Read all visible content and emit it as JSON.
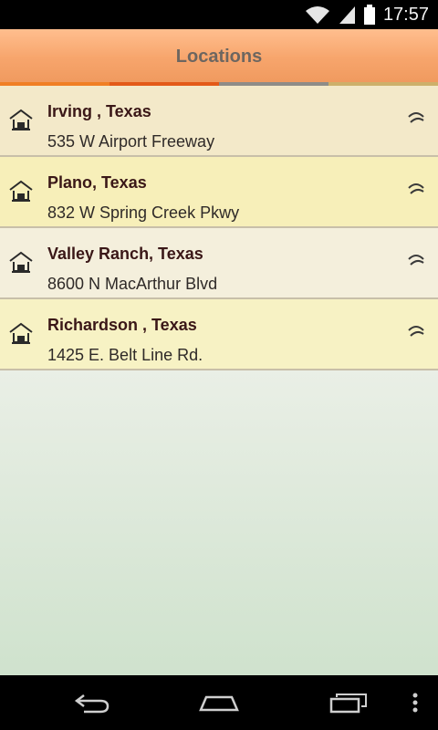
{
  "status_bar": {
    "time": "17:57",
    "icons": [
      "wifi-icon",
      "cell-signal-icon",
      "battery-icon"
    ],
    "color": "#ffffff"
  },
  "app_bar": {
    "title": "Locations",
    "background": "#f7a56c",
    "accent_colors": [
      "#f07f24",
      "#e35a18",
      "#8e8c88",
      "#cdb06a"
    ]
  },
  "locations": [
    {
      "title": "Irving , Texas",
      "address": "535 W Airport Freeway",
      "icon": "house-icon",
      "action_icon": "chevron-icon"
    },
    {
      "title": "Plano, Texas",
      "address": "832 W Spring Creek Pkwy",
      "icon": "house-icon",
      "action_icon": "chevron-icon"
    },
    {
      "title": "Valley Ranch, Texas",
      "address": "8600 N MacArthur Blvd",
      "icon": "house-icon",
      "action_icon": "chevron-icon"
    },
    {
      "title": "Richardson , Texas",
      "address": "1425 E. Belt Line Rd.",
      "icon": "house-icon",
      "action_icon": "chevron-icon"
    }
  ],
  "nav_bar": {
    "buttons": [
      "back-icon",
      "home-icon",
      "recent-apps-icon",
      "overflow-menu-icon"
    ]
  }
}
